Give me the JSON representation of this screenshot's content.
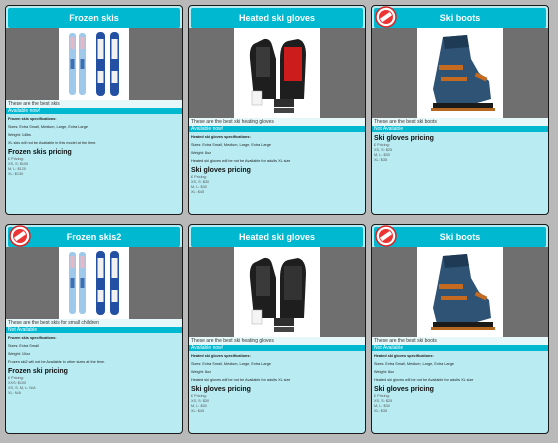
{
  "colors": {
    "accent": "#00b8d0",
    "card_bg": "#b8ecf2",
    "page_bg": "#b9b9b9"
  },
  "cards": [
    {
      "title": "Frozen skis",
      "badge": false,
      "product": "skis",
      "caption": "These are the best skis",
      "availability": "Available now!",
      "spec_title": "Frozen skis specifications:",
      "sizes": "Sizes: Extra Small, Medium, Large, Extra Large",
      "weight": "Weight: 14lbs",
      "note": "XL skis will not be Available in this model at the time.",
      "pricing_heading": "Frozen skis pricing",
      "prices": [
        "£ Pricing:",
        "XS, S: $100",
        "M, L: $120",
        "XL: $130"
      ]
    },
    {
      "title": "Heated ski gloves",
      "badge": false,
      "product": "gloves",
      "caption": "These are the best ski heating gloves",
      "availability": "Available now!",
      "spec_title": "Heated ski gloves specifications:",
      "sizes": "Sizes: Extra Small, Medium, Large, Extra Large",
      "weight": "Weight: 8oz",
      "note": "Heated ski gloves will be not be Available for adults XL size",
      "pricing_heading": "Ski gloves pricing",
      "prices": [
        "£ Pricing:",
        "XS, S: $30",
        "M, L: $30",
        "XL: $45"
      ]
    },
    {
      "title": "Ski boots",
      "badge": true,
      "product": "boots",
      "caption": "These are the best ski boots",
      "availability": "Not Available",
      "spec_title": "",
      "sizes": "",
      "weight": "",
      "note": "",
      "pricing_heading": "Ski gloves pricing",
      "prices": [
        "£ Pricing:",
        "XS, S: $25",
        "M, L: $30",
        "XL: $35"
      ]
    },
    {
      "title": "Frozen skis2",
      "badge": true,
      "product": "skis",
      "caption": "These are the best skis for small children",
      "availability": "Not Available",
      "spec_title": "Frozen skis specifications:",
      "sizes": "Sizes: Extra Small",
      "weight": "Weight: 10oz",
      "note": "Frozen ski2 will not be Available in other sizes at the time.",
      "pricing_heading": "Frozen ski pricing",
      "prices": [
        "£ Pricing:",
        "XXS: $100",
        "XS, S, M, L: N/A",
        "XL: N/A"
      ]
    },
    {
      "title": "Heated ski gloves",
      "badge": false,
      "product": "gloves",
      "caption": "These are the best ski heating gloves",
      "availability": "Available now!",
      "spec_title": "Heated ski gloves specifications:",
      "sizes": "Sizes: Extra Small, Medium, Large, Extra Large",
      "weight": "Weight: 8oz",
      "note": "Heated ski gloves will be not be Available for adults XL size",
      "pricing_heading": "Ski gloves pricing",
      "prices": [
        "£ Pricing:",
        "XS, S: $30",
        "M, L: $30",
        "XL: $45"
      ]
    },
    {
      "title": "Ski boots",
      "badge": true,
      "product": "boots",
      "caption": "These are the best ski boots",
      "availability": "Not Available",
      "spec_title": "Heated ski gloves specifications:",
      "sizes": "Sizes: Extra Small, Medium, Large, Extra Large",
      "weight": "Weight: 8oz",
      "note": "Heated ski gloves will be not be Available for adults XL size",
      "pricing_heading": "Ski gloves pricing",
      "prices": [
        "£ Pricing:",
        "XS, S: $25",
        "M, L: $30",
        "XL: $35"
      ]
    }
  ]
}
